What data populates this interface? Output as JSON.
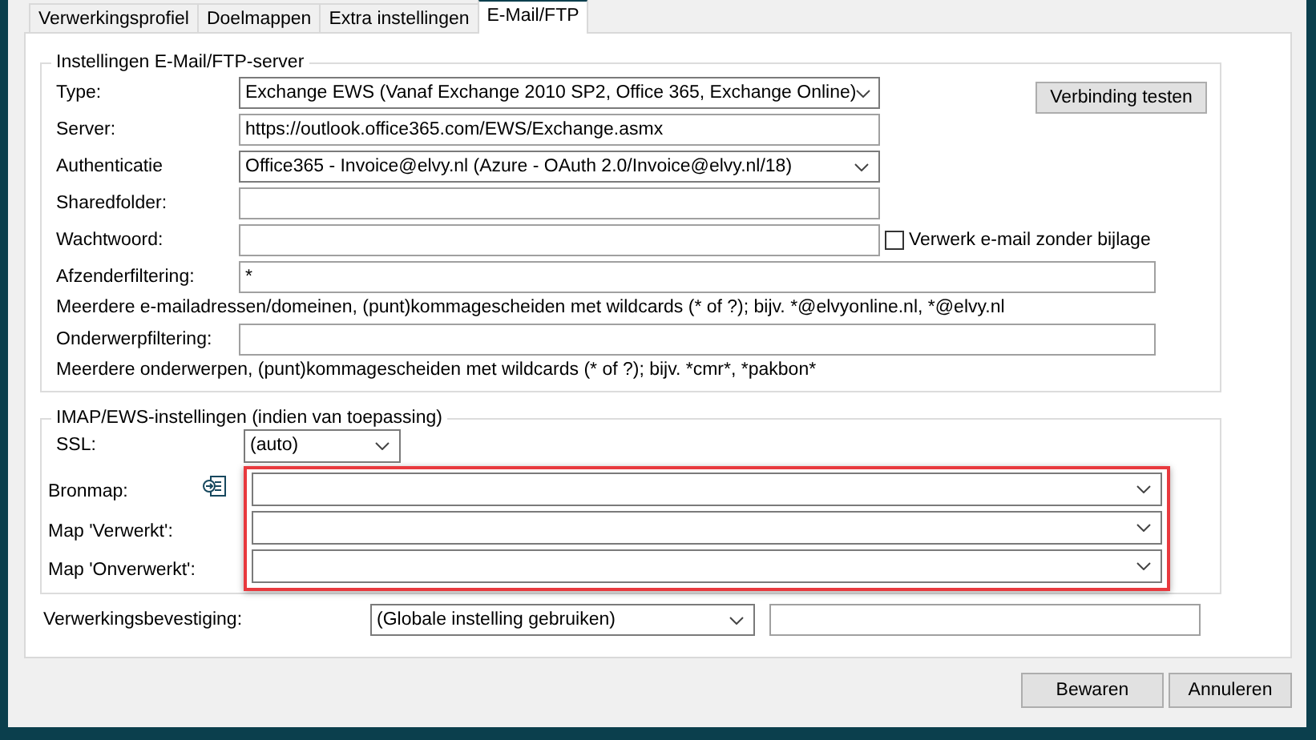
{
  "tabs": [
    {
      "label": "Verwerkingsprofiel",
      "selected": false
    },
    {
      "label": "Doelmappen",
      "selected": false
    },
    {
      "label": "Extra instellingen",
      "selected": false
    },
    {
      "label": "E-Mail/FTP",
      "selected": true
    }
  ],
  "server_group": {
    "title": "Instellingen E-Mail/FTP-server",
    "test_button": "Verbinding testen",
    "rows": [
      {
        "kind": "select",
        "label": "Type:",
        "value": "Exchange EWS (Vanaf Exchange 2010 SP2, Office 365, Exchange Online)"
      },
      {
        "kind": "input",
        "label": "Server:",
        "value": "https://outlook.office365.com/EWS/Exchange.asmx"
      },
      {
        "kind": "select",
        "label": "Authenticatie",
        "value": "Office365 - Invoice@elvy.nl (Azure - OAuth 2.0/Invoice@elvy.nl/18)"
      },
      {
        "kind": "input",
        "label": "Sharedfolder:"
      },
      {
        "kind": "input",
        "label": "Wachtwoord:",
        "checkbox": {
          "label": "Verwerk e-mail zonder bijlage",
          "checked": false
        }
      },
      {
        "kind": "input_long",
        "label": "Afzenderfiltering:",
        "value": "*"
      },
      {
        "kind": "hint",
        "text": "Meerdere e-mailadressen/domeinen, (punt)kommagescheiden met wildcards (* of ?); bijv. *@elvyonline.nl, *@elvy.nl"
      },
      {
        "kind": "input_long",
        "label": "Onderwerpfiltering:"
      },
      {
        "kind": "hint",
        "text": "Meerdere onderwerpen, (punt)kommagescheiden met wildcards (* of ?); bijv. *cmr*, *pakbon*"
      }
    ]
  },
  "imap_group": {
    "title": "IMAP/EWS-instellingen (indien van toepassing)",
    "ssl": {
      "label": "SSL:",
      "value": "(auto)"
    },
    "highlighted": true,
    "folders": [
      {
        "kind": "browse",
        "label": "Bronmap:"
      },
      {
        "kind": "plain",
        "label": "Map 'Verwerkt':"
      },
      {
        "kind": "plain",
        "label": "Map 'Onverwerkt':"
      }
    ]
  },
  "confirmation": {
    "label": "Verwerkingsbevestiging:",
    "value": "(Globale instelling gebruiken)"
  },
  "buttons": [
    "Bewaren",
    "Annuleren"
  ]
}
